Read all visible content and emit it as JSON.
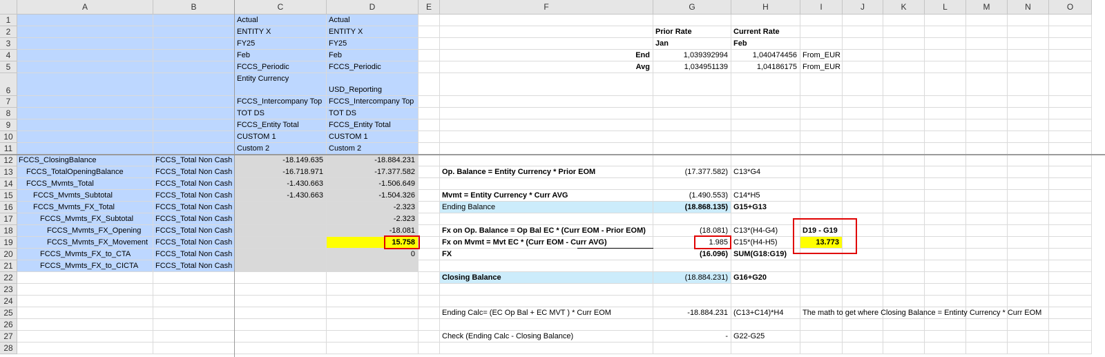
{
  "columns": [
    "A",
    "B",
    "C",
    "D",
    "E",
    "F",
    "G",
    "H",
    "I",
    "J",
    "K",
    "L",
    "M",
    "N",
    "O"
  ],
  "rows": [
    1,
    2,
    3,
    4,
    5,
    6,
    7,
    8,
    9,
    10,
    11,
    12,
    13,
    14,
    15,
    16,
    17,
    18,
    19,
    20,
    21,
    22,
    23,
    24,
    25,
    26,
    27,
    28
  ],
  "cells": [
    {
      "col": "C",
      "row": 1,
      "v": "Actual",
      "f": "blue"
    },
    {
      "col": "D",
      "row": 1,
      "v": "Actual",
      "f": "blue"
    },
    {
      "col": "C",
      "row": 2,
      "v": "ENTITY X",
      "f": "blue"
    },
    {
      "col": "D",
      "row": 2,
      "v": "ENTITY X",
      "f": "blue"
    },
    {
      "col": "G",
      "row": 2,
      "v": "Prior Rate",
      "b": true
    },
    {
      "col": "H",
      "row": 2,
      "v": "Current Rate",
      "b": true
    },
    {
      "col": "C",
      "row": 3,
      "v": "FY25",
      "f": "blue"
    },
    {
      "col": "D",
      "row": 3,
      "v": "FY25",
      "f": "blue"
    },
    {
      "col": "G",
      "row": 3,
      "v": "Jan",
      "b": true
    },
    {
      "col": "H",
      "row": 3,
      "v": "Feb",
      "b": true
    },
    {
      "col": "C",
      "row": 4,
      "v": "Feb",
      "f": "blue"
    },
    {
      "col": "D",
      "row": 4,
      "v": "Feb",
      "f": "blue"
    },
    {
      "col": "F",
      "row": 4,
      "v": "End",
      "b": true,
      "a": "r"
    },
    {
      "col": "G",
      "row": 4,
      "v": "1,039392994",
      "a": "r"
    },
    {
      "col": "H",
      "row": 4,
      "v": "1,040474456",
      "a": "r"
    },
    {
      "col": "I",
      "row": 4,
      "v": "From_EUR"
    },
    {
      "col": "C",
      "row": 5,
      "v": "FCCS_Periodic",
      "f": "blue"
    },
    {
      "col": "D",
      "row": 5,
      "v": "FCCS_Periodic",
      "f": "blue"
    },
    {
      "col": "F",
      "row": 5,
      "v": "Avg",
      "b": true,
      "a": "r"
    },
    {
      "col": "G",
      "row": 5,
      "v": "1,034951139",
      "a": "r"
    },
    {
      "col": "H",
      "row": 5,
      "v": "1,04186175",
      "a": "r"
    },
    {
      "col": "I",
      "row": 5,
      "v": "From_EUR"
    },
    {
      "col": "C",
      "row": 6,
      "v": "Entity Currency",
      "f": "blue",
      "va": "top"
    },
    {
      "col": "D",
      "row": 6,
      "v": "USD_Reporting",
      "f": "blue"
    },
    {
      "col": "C",
      "row": 7,
      "v": "FCCS_Intercompany Top",
      "f": "blue"
    },
    {
      "col": "D",
      "row": 7,
      "v": "FCCS_Intercompany Top",
      "f": "blue"
    },
    {
      "col": "C",
      "row": 8,
      "v": "TOT DS",
      "f": "blue"
    },
    {
      "col": "D",
      "row": 8,
      "v": "TOT DS",
      "f": "blue"
    },
    {
      "col": "C",
      "row": 9,
      "v": "FCCS_Entity Total",
      "f": "blue"
    },
    {
      "col": "D",
      "row": 9,
      "v": "FCCS_Entity Total",
      "f": "blue"
    },
    {
      "col": "C",
      "row": 10,
      "v": "CUSTOM 1",
      "f": "blue"
    },
    {
      "col": "D",
      "row": 10,
      "v": "CUSTOM 1",
      "f": "blue"
    },
    {
      "col": "C",
      "row": 11,
      "v": "Custom 2",
      "f": "blue"
    },
    {
      "col": "D",
      "row": 11,
      "v": "Custom 2",
      "f": "blue"
    },
    {
      "col": "A",
      "row": 12,
      "v": "FCCS_ClosingBalance",
      "f": "blue",
      "ind": 0
    },
    {
      "col": "B",
      "row": 12,
      "v": "FCCS_Total Non Cash",
      "f": "blue"
    },
    {
      "col": "C",
      "row": 12,
      "v": "-18.149.635",
      "f": "gray",
      "a": "r"
    },
    {
      "col": "D",
      "row": 12,
      "v": "-18.884.231",
      "f": "gray",
      "a": "r"
    },
    {
      "col": "A",
      "row": 13,
      "v": "FCCS_TotalOpeningBalance",
      "f": "blue",
      "ind": 1
    },
    {
      "col": "B",
      "row": 13,
      "v": "FCCS_Total Non Cash",
      "f": "blue"
    },
    {
      "col": "C",
      "row": 13,
      "v": "-16.718.971",
      "f": "gray",
      "a": "r"
    },
    {
      "col": "D",
      "row": 13,
      "v": "-17.377.582",
      "f": "gray",
      "a": "r"
    },
    {
      "col": "F",
      "row": 13,
      "v": "Op. Balance = Entity Currency * Prior EOM",
      "b": true
    },
    {
      "col": "G",
      "row": 13,
      "v": "(17.377.582)",
      "a": "r"
    },
    {
      "col": "H",
      "row": 13,
      "v": "C13*G4"
    },
    {
      "col": "A",
      "row": 14,
      "v": "FCCS_Mvmts_Total",
      "f": "blue",
      "ind": 1
    },
    {
      "col": "B",
      "row": 14,
      "v": "FCCS_Total Non Cash",
      "f": "blue"
    },
    {
      "col": "C",
      "row": 14,
      "v": "-1.430.663",
      "f": "gray",
      "a": "r"
    },
    {
      "col": "D",
      "row": 14,
      "v": "-1.506.649",
      "f": "gray",
      "a": "r"
    },
    {
      "col": "A",
      "row": 15,
      "v": "FCCS_Mvmts_Subtotal",
      "f": "blue",
      "ind": 2
    },
    {
      "col": "B",
      "row": 15,
      "v": "FCCS_Total Non Cash",
      "f": "blue"
    },
    {
      "col": "C",
      "row": 15,
      "v": "-1.430.663",
      "f": "gray",
      "a": "r"
    },
    {
      "col": "D",
      "row": 15,
      "v": "-1.504.326",
      "f": "gray",
      "a": "r"
    },
    {
      "col": "F",
      "row": 15,
      "v": "Mvmt = Entity Currency * Curr AVG",
      "b": true
    },
    {
      "col": "G",
      "row": 15,
      "v": "(1.490.553)",
      "a": "r"
    },
    {
      "col": "H",
      "row": 15,
      "v": "C14*H5"
    },
    {
      "col": "A",
      "row": 16,
      "v": "FCCS_Mvmts_FX_Total",
      "f": "blue",
      "ind": 2
    },
    {
      "col": "B",
      "row": 16,
      "v": "FCCS_Total Non Cash",
      "f": "blue"
    },
    {
      "col": "C",
      "row": 16,
      "v": "",
      "f": "gray"
    },
    {
      "col": "D",
      "row": 16,
      "v": "-2.323",
      "f": "gray",
      "a": "r"
    },
    {
      "col": "F",
      "row": 16,
      "v": "Ending Balance",
      "f": "lblue"
    },
    {
      "col": "G",
      "row": 16,
      "v": "(18.868.135)",
      "f": "lblue",
      "b": true,
      "a": "r"
    },
    {
      "col": "H",
      "row": 16,
      "v": "G15+G13",
      "b": true
    },
    {
      "col": "A",
      "row": 17,
      "v": "FCCS_Mvmts_FX_Subtotal",
      "f": "blue",
      "ind": 3
    },
    {
      "col": "B",
      "row": 17,
      "v": "FCCS_Total Non Cash",
      "f": "blue"
    },
    {
      "col": "C",
      "row": 17,
      "v": "",
      "f": "gray"
    },
    {
      "col": "D",
      "row": 17,
      "v": "-2.323",
      "f": "gray",
      "a": "r"
    },
    {
      "col": "A",
      "row": 18,
      "v": "FCCS_Mvmts_FX_Opening",
      "f": "blue",
      "ind": 4
    },
    {
      "col": "B",
      "row": 18,
      "v": "FCCS_Total Non Cash",
      "f": "blue"
    },
    {
      "col": "C",
      "row": 18,
      "v": "",
      "f": "gray"
    },
    {
      "col": "D",
      "row": 18,
      "v": "-18.081",
      "f": "gray",
      "a": "r"
    },
    {
      "col": "F",
      "row": 18,
      "v": "Fx on Op. Balance = Op Bal EC * (Curr EOM - Prior EOM)",
      "b": true
    },
    {
      "col": "G",
      "row": 18,
      "v": "(18.081)",
      "a": "r"
    },
    {
      "col": "H",
      "row": 18,
      "v": "C13*(H4-G4)"
    },
    {
      "col": "I",
      "row": 18,
      "v": "D19 - G19",
      "b": true
    },
    {
      "col": "A",
      "row": 19,
      "v": "FCCS_Mvmts_FX_Movement",
      "f": "blue",
      "ind": 4
    },
    {
      "col": "B",
      "row": 19,
      "v": "FCCS_Total Non Cash",
      "f": "blue"
    },
    {
      "col": "C",
      "row": 19,
      "v": "",
      "f": "gray"
    },
    {
      "col": "D",
      "row": 19,
      "v": "15.758",
      "f": "yellow",
      "b": true,
      "a": "r"
    },
    {
      "col": "F",
      "row": 19,
      "v": "Fx on Mvmt = Mvt EC * (Curr EOM - Curr AVG)",
      "b": true
    },
    {
      "col": "G",
      "row": 19,
      "v": "1.985",
      "a": "r"
    },
    {
      "col": "H",
      "row": 19,
      "v": "C15*(H4-H5)"
    },
    {
      "col": "I",
      "row": 19,
      "v": "13.773",
      "f": "yellow",
      "b": true,
      "a": "r"
    },
    {
      "col": "A",
      "row": 20,
      "v": "FCCS_Mvmts_FX_to_CTA",
      "f": "blue",
      "ind": 3
    },
    {
      "col": "B",
      "row": 20,
      "v": "FCCS_Total Non Cash",
      "f": "blue"
    },
    {
      "col": "C",
      "row": 20,
      "v": "",
      "f": "gray"
    },
    {
      "col": "D",
      "row": 20,
      "v": "0",
      "f": "gray",
      "a": "r"
    },
    {
      "col": "F",
      "row": 20,
      "v": "FX",
      "b": true
    },
    {
      "col": "G",
      "row": 20,
      "v": "(16.096)",
      "b": true,
      "a": "r"
    },
    {
      "col": "H",
      "row": 20,
      "v": "SUM(G18:G19)",
      "b": true
    },
    {
      "col": "A",
      "row": 21,
      "v": "FCCS_Mvmts_FX_to_CICTA",
      "f": "blue",
      "ind": 3
    },
    {
      "col": "B",
      "row": 21,
      "v": "FCCS_Total Non Cash",
      "f": "blue"
    },
    {
      "col": "C",
      "row": 21,
      "v": "",
      "f": "gray"
    },
    {
      "col": "D",
      "row": 21,
      "v": "",
      "f": "gray"
    },
    {
      "col": "F",
      "row": 22,
      "v": "Closing Balance",
      "f": "lblue",
      "b": true
    },
    {
      "col": "G",
      "row": 22,
      "v": "(18.884.231)",
      "f": "lblue",
      "a": "r"
    },
    {
      "col": "H",
      "row": 22,
      "v": "G16+G20",
      "b": true
    },
    {
      "col": "F",
      "row": 25,
      "v": "Ending Calc= (EC Op Bal + EC MVT ) * Curr EOM"
    },
    {
      "col": "G",
      "row": 25,
      "v": "-18.884.231",
      "a": "r"
    },
    {
      "col": "H",
      "row": 25,
      "v": "(C13+C14)*H4"
    },
    {
      "col": "I",
      "row": 25,
      "v": "The math to get where Closing Balance = Entinty Currency * Curr EOM"
    },
    {
      "col": "F",
      "row": 27,
      "v": "Check (Ending Calc - Closing Balance)"
    },
    {
      "col": "G",
      "row": 27,
      "v": "-",
      "a": "r"
    },
    {
      "col": "H",
      "row": 27,
      "v": "G22-G25"
    }
  ]
}
